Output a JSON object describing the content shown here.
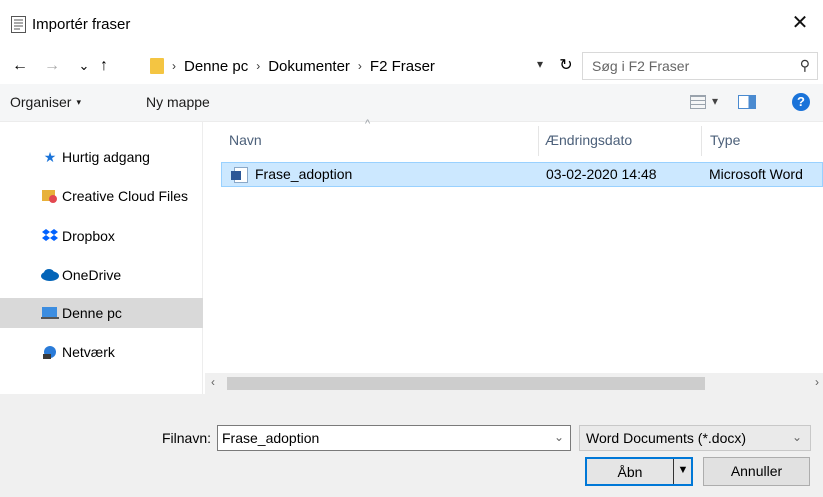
{
  "window": {
    "title": "Importér fraser",
    "close_glyph": "✕"
  },
  "nav": {
    "back_glyph": "←",
    "forward_glyph": "→",
    "recent_glyph": "⌄",
    "up_glyph": "↑",
    "breadcrumb": [
      "Denne pc",
      "Dokumenter",
      "F2 Fraser"
    ],
    "crumb_separator": "›",
    "refresh_glyph": "↻",
    "search_placeholder": "Søg i F2 Fraser"
  },
  "toolbar": {
    "organize_label": "Organiser",
    "new_folder_label": "Ny mappe",
    "help_glyph": "?"
  },
  "sidebar": {
    "items": [
      {
        "label": "Hurtig adgang",
        "icon": "star-icon"
      },
      {
        "label": "Creative Cloud Files",
        "icon": "creative-cloud-folder-icon"
      },
      {
        "label": "Dropbox",
        "icon": "dropbox-icon"
      },
      {
        "label": "OneDrive",
        "icon": "onedrive-cloud-icon"
      },
      {
        "label": "Denne pc",
        "icon": "computer-icon",
        "selected": true
      },
      {
        "label": "Netværk",
        "icon": "network-icon"
      }
    ]
  },
  "files": {
    "columns": [
      "Navn",
      "Ændringsdato",
      "Type"
    ],
    "rows": [
      {
        "name": "Frase_adoption",
        "date": "03-02-2020 14:48",
        "type": "Microsoft Word",
        "icon": "word-document-icon",
        "selected": true
      }
    ]
  },
  "footer": {
    "filename_label": "Filnavn:",
    "filename_value": "Frase_adoption",
    "filetype_value": "Word Documents (*.docx)",
    "open_label": "Åbn",
    "cancel_label": "Annuller"
  },
  "colors": {
    "selection": "#cce8ff",
    "selection_border": "#99d1ff",
    "accent": "#0078d7"
  }
}
